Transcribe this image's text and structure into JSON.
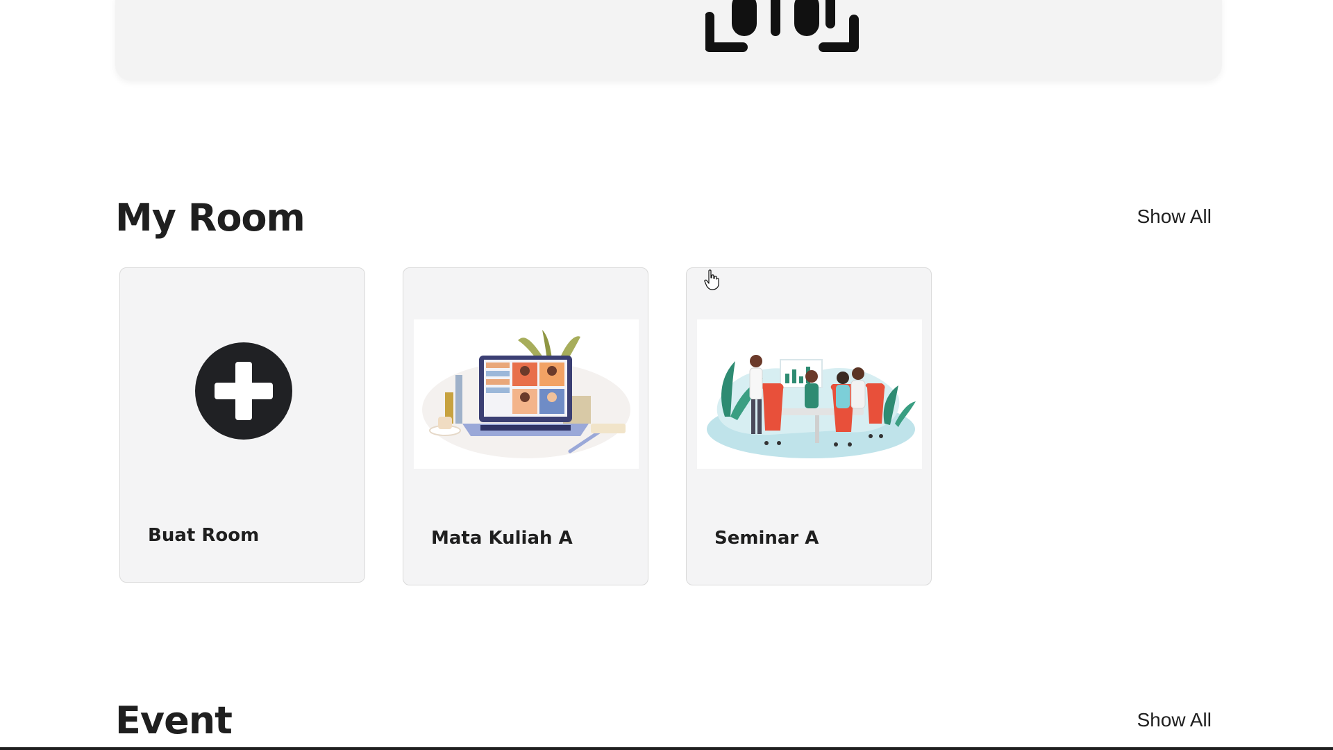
{
  "header": {
    "logo_icon": "brand-logo-icon"
  },
  "my_room": {
    "title": "My Room",
    "show_all_label": "Show All",
    "cards": [
      {
        "label": "Buat Room",
        "icon": "plus-circle-icon"
      },
      {
        "label": "Mata Kuliah A",
        "illustration": "video-call-laptop-illustration"
      },
      {
        "label": "Seminar A",
        "illustration": "team-meeting-illustration"
      }
    ]
  },
  "event": {
    "title": "Event",
    "show_all_label": "Show All"
  },
  "colors": {
    "header_bg": "#f3f3f3",
    "card_bg": "#f4f4f5",
    "text": "#1f1f1f",
    "accent_red": "#e8503a",
    "accent_teal": "#7ccfd8"
  }
}
